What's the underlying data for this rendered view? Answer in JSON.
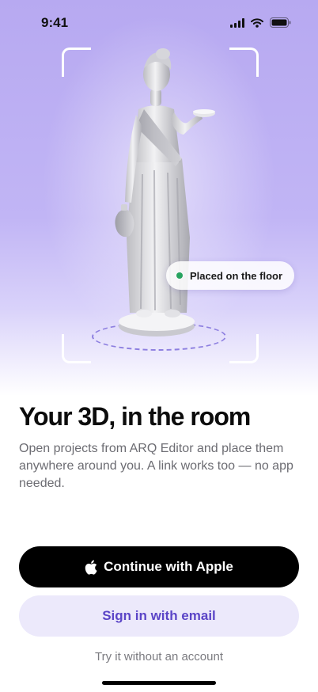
{
  "status_bar": {
    "time": "9:41",
    "icons": [
      "cellular-signal-icon",
      "wifi-icon",
      "battery-icon"
    ]
  },
  "hero": {
    "image": "statue-3d-model",
    "placed_chip": {
      "label": "Placed on the floor",
      "dot_color": "#27a35f"
    }
  },
  "onboarding": {
    "headline": "Your 3D, in the room",
    "body": "Open projects from ARQ Editor and place them anywhere around you. A link works too — no app needed."
  },
  "actions": {
    "apple_label": "Continue with Apple",
    "email_label": "Sign in with email",
    "skip_label": "Try it without an account"
  },
  "colors": {
    "accent": "#5b45c7",
    "hero_purple": "#b7a9f1",
    "email_button_bg": "#ece9fb",
    "primary_button_bg": "#000000"
  }
}
